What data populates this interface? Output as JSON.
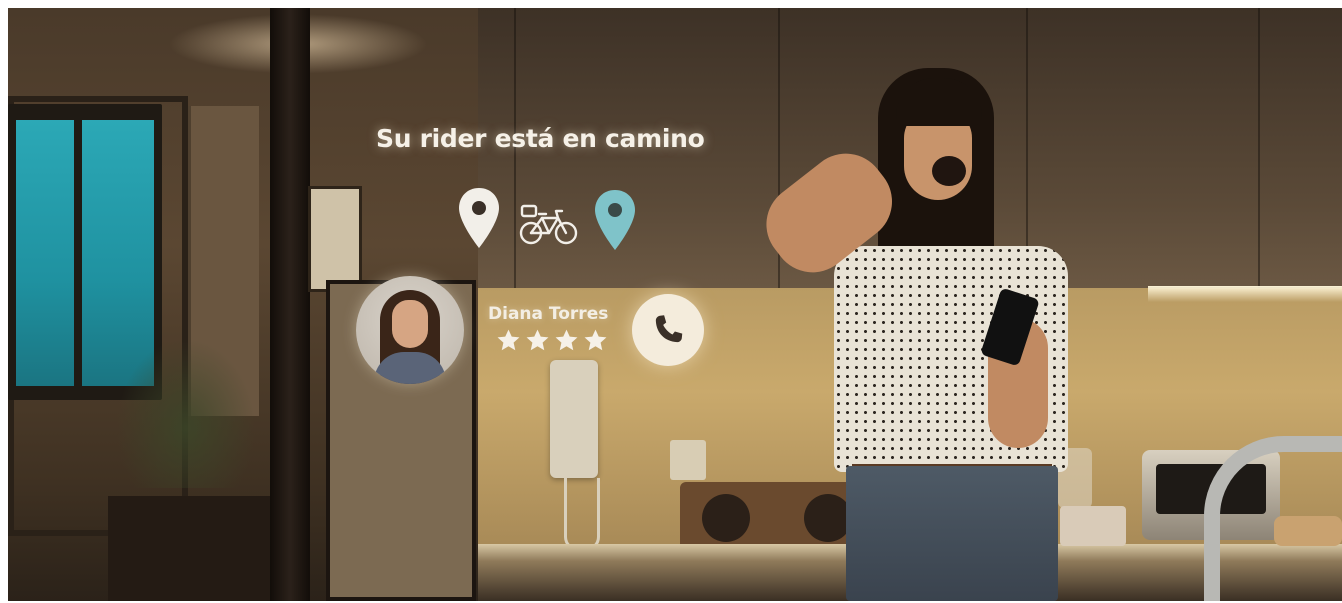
{
  "overlay": {
    "status_text": "Su rider está en camino",
    "rider": {
      "name": "Diana Torres",
      "rating_stars": 4
    },
    "icons": {
      "origin": "location-pin-icon",
      "vehicle": "bicycle-icon",
      "destination": "location-pin-icon",
      "call": "phone-icon",
      "rating": "star-icon"
    },
    "colors": {
      "origin_pin": "#f2efe9",
      "destination_pin": "#7fc3c9",
      "text": "#f6f1e8",
      "call_button": "#f4ecdc"
    }
  }
}
